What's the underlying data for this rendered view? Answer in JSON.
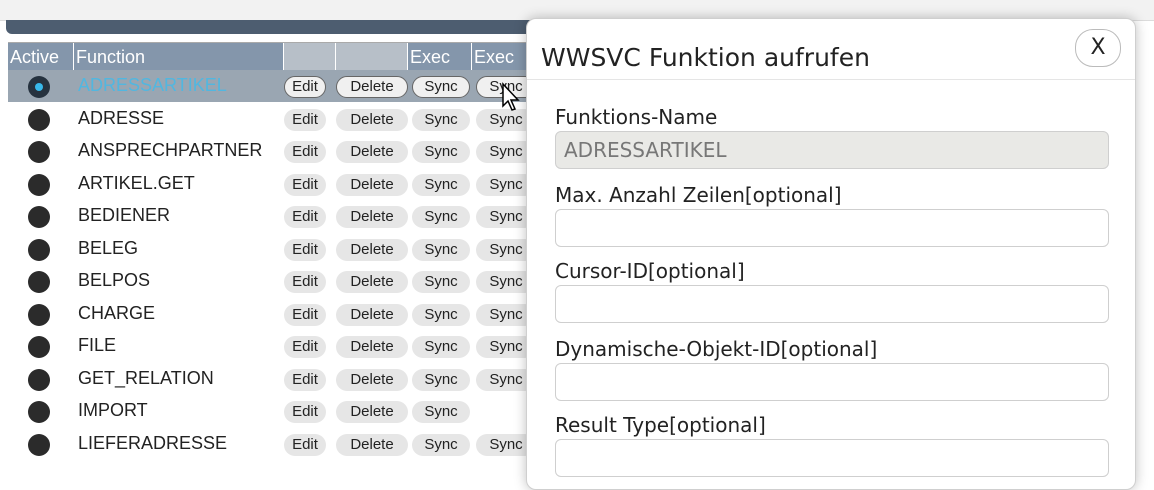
{
  "headers": {
    "active": "Active",
    "function": "Function",
    "exec1": "Exec",
    "exec2": "Exec"
  },
  "buttons": {
    "edit": "Edit",
    "delete": "Delete",
    "sync": "Sync"
  },
  "rows": [
    {
      "name": "ADRESSARTIKEL",
      "selected": true,
      "sync2": true
    },
    {
      "name": "ADRESSE",
      "sync2": true
    },
    {
      "name": "ANSPRECHPARTNER",
      "sync2": true
    },
    {
      "name": "ARTIKEL.GET",
      "sync2": true
    },
    {
      "name": "BEDIENER",
      "sync2": true
    },
    {
      "name": "BELEG",
      "sync2": true
    },
    {
      "name": "BELPOS",
      "sync2": true
    },
    {
      "name": "CHARGE",
      "sync2": true
    },
    {
      "name": "FILE",
      "sync2": true
    },
    {
      "name": "GET_RELATION",
      "sync2": true
    },
    {
      "name": "IMPORT",
      "sync2": false
    },
    {
      "name": "LIEFERADRESSE",
      "sync2": true
    }
  ],
  "dialog": {
    "title": "WWSVC Funktion aufrufen",
    "close": "X",
    "fields": [
      {
        "label": "Funktions-Name",
        "value": "ADRESSARTIKEL",
        "readonly": true
      },
      {
        "label": "Max. Anzahl Zeilen[optional]",
        "value": ""
      },
      {
        "label": "Cursor-ID[optional]",
        "value": ""
      },
      {
        "label": "Dynamische-Objekt-ID[optional]",
        "value": ""
      },
      {
        "label": "Result Type[optional]",
        "value": ""
      }
    ]
  }
}
